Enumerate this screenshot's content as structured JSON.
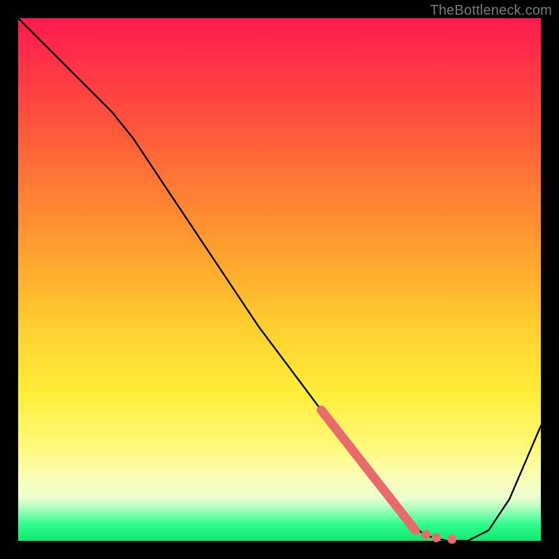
{
  "watermark": "TheBottleneck.com",
  "chart_data": {
    "type": "line",
    "title": "",
    "xlabel": "",
    "ylabel": "",
    "xlim": [
      0,
      100
    ],
    "ylim": [
      0,
      100
    ],
    "grid": false,
    "legend": false,
    "series": [
      {
        "name": "bottleneck-curve",
        "color": "#000000",
        "x": [
          0,
          6,
          12,
          18,
          22,
          28,
          34,
          40,
          46,
          52,
          58,
          64,
          70,
          74,
          78,
          82,
          86,
          90,
          94,
          100
        ],
        "y": [
          100,
          94,
          88,
          82,
          77,
          68,
          59,
          50,
          41,
          33,
          25,
          17,
          9,
          4,
          1,
          0,
          0,
          2,
          8,
          22
        ]
      }
    ],
    "highlight": {
      "name": "bottleneck-range",
      "color": "#e96a6a",
      "segment": {
        "x": [
          58,
          76
        ],
        "y": [
          25,
          2
        ]
      },
      "dots_x": [
        78,
        80,
        83
      ],
      "dots_y": [
        1.2,
        0.6,
        0.3
      ]
    }
  }
}
